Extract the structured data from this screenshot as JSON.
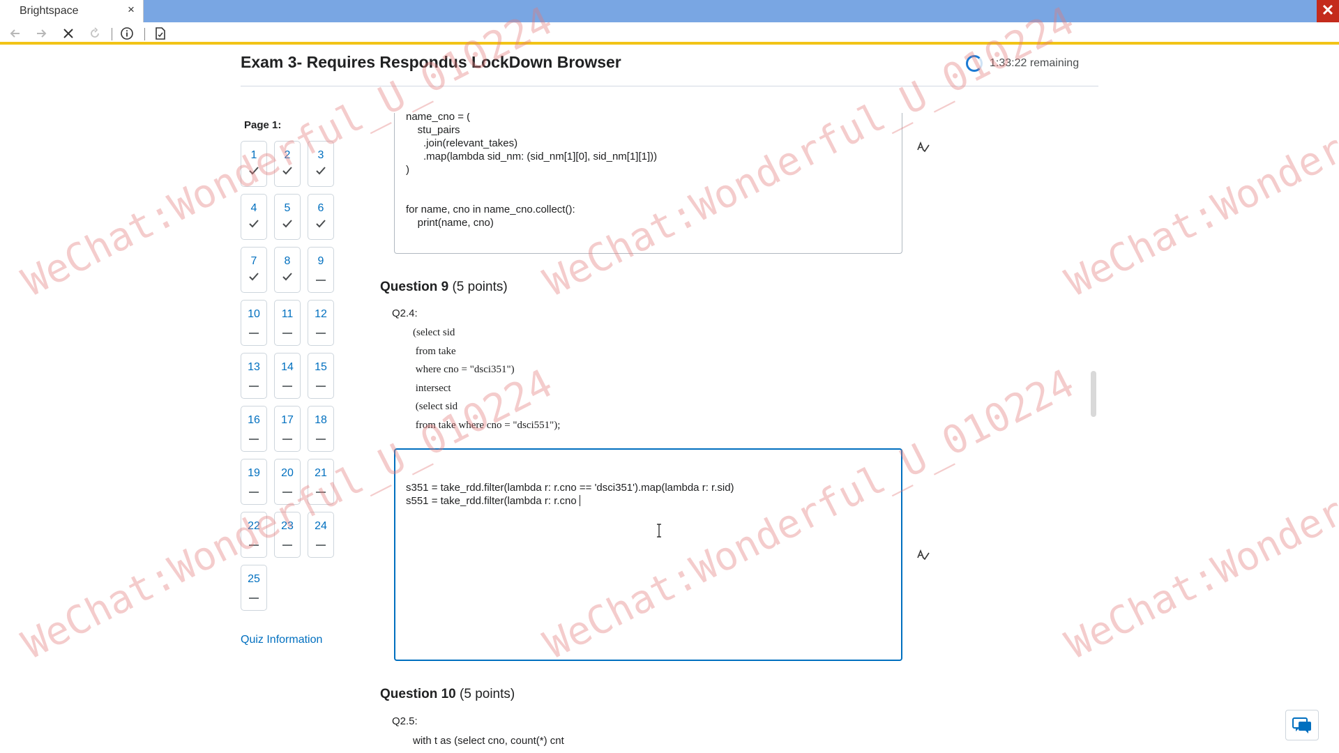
{
  "window": {
    "tab_title": "Brightspace",
    "tab_close": "×",
    "close": "✕"
  },
  "exam": {
    "title": "Exam 3- Requires Respondus LockDown Browser",
    "timer": "1:33:22 remaining"
  },
  "nav": {
    "page_label": "Page 1:",
    "questions": [
      {
        "num": "1",
        "answered": true
      },
      {
        "num": "2",
        "answered": true
      },
      {
        "num": "3",
        "answered": true
      },
      {
        "num": "4",
        "answered": true
      },
      {
        "num": "5",
        "answered": true
      },
      {
        "num": "6",
        "answered": true
      },
      {
        "num": "7",
        "answered": true
      },
      {
        "num": "8",
        "answered": true
      },
      {
        "num": "9",
        "answered": false
      },
      {
        "num": "10",
        "answered": false
      },
      {
        "num": "11",
        "answered": false
      },
      {
        "num": "12",
        "answered": false
      },
      {
        "num": "13",
        "answered": false
      },
      {
        "num": "14",
        "answered": false
      },
      {
        "num": "15",
        "answered": false
      },
      {
        "num": "16",
        "answered": false
      },
      {
        "num": "17",
        "answered": false
      },
      {
        "num": "18",
        "answered": false
      },
      {
        "num": "19",
        "answered": false
      },
      {
        "num": "20",
        "answered": false
      },
      {
        "num": "21",
        "answered": false
      },
      {
        "num": "22",
        "answered": false
      },
      {
        "num": "23",
        "answered": false
      },
      {
        "num": "24",
        "answered": false
      },
      {
        "num": "25",
        "answered": false
      }
    ],
    "quiz_information": "Quiz Information"
  },
  "prev_answer": {
    "lines": [
      "name_cno = (",
      "    stu_pairs",
      "      .join(relevant_takes)",
      "      .map(lambda sid_nm: (sid_nm[1][0], sid_nm[1][1]))",
      ")",
      "",
      "",
      "for name, cno in name_cno.collect():",
      "    print(name, cno)"
    ]
  },
  "question9": {
    "title": "Question 9",
    "points": "(5 points)",
    "label": "Q2.4:",
    "sql": "(select sid\n from take\n where cno = \"dsci351\")\n intersect\n (select sid\n from take where cno = \"dsci551\");",
    "answer": "s351 = take_rdd.filter(lambda r: r.cno == 'dsci351').map(lambda r: r.sid)\ns551 = take_rdd.filter(lambda r: r.cno "
  },
  "question10": {
    "title": "Question 10",
    "points": "(5 points)",
    "label": "Q2.5:",
    "sql": "with t as (select cno, count(*) cnt"
  },
  "watermark": {
    "text": "WeChat:Wonderful_U_010224"
  },
  "icons": {
    "back": "arrow-left-icon",
    "forward": "arrow-right-icon",
    "stop": "x-icon",
    "reload": "refresh-icon",
    "info": "info-icon",
    "page": "page-icon",
    "spellcheck": "spellcheck-icon",
    "chat": "chat-icon",
    "check": "check-icon"
  }
}
